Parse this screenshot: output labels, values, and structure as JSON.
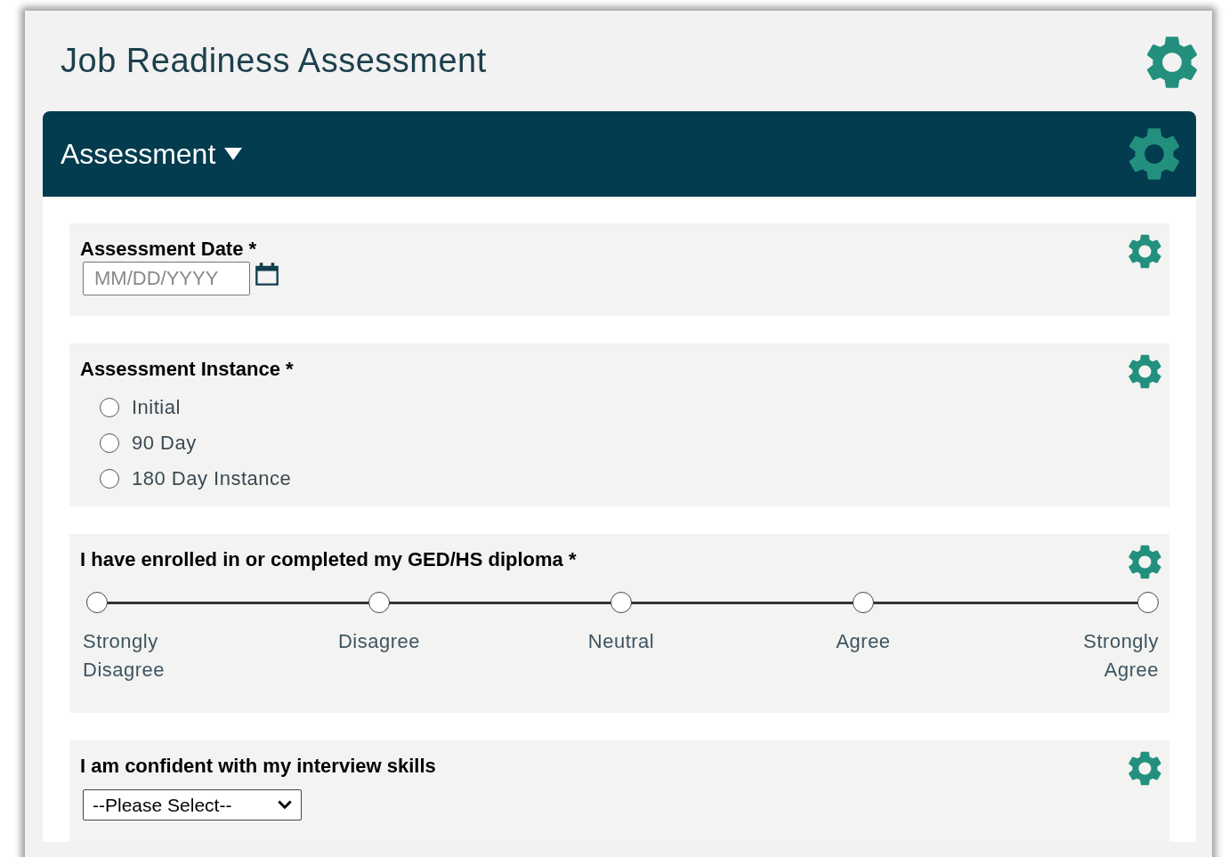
{
  "page": {
    "title": "Job Readiness Assessment"
  },
  "section": {
    "title": "Assessment",
    "expanded": true
  },
  "fields": [
    {
      "kind": "date",
      "label": "Assessment Date *",
      "placeholder": "MM/DD/YYYY"
    },
    {
      "kind": "radio",
      "label": "Assessment Instance *",
      "options": [
        {
          "label": "Initial",
          "selected": false
        },
        {
          "label": "90 Day",
          "selected": false
        },
        {
          "label": "180 Day Instance",
          "selected": false
        }
      ]
    },
    {
      "kind": "likert",
      "label": "I have enrolled in or completed my GED/HS diploma *",
      "options": [
        {
          "label": "Strongly Disagree",
          "selected": false
        },
        {
          "label": "Disagree",
          "selected": false
        },
        {
          "label": "Neutral",
          "selected": false
        },
        {
          "label": "Agree",
          "selected": false
        },
        {
          "label": "Strongly Agree",
          "selected": false
        }
      ]
    },
    {
      "kind": "select",
      "label": "I am confident with my interview skills",
      "value": "--Please Select--"
    }
  ]
}
